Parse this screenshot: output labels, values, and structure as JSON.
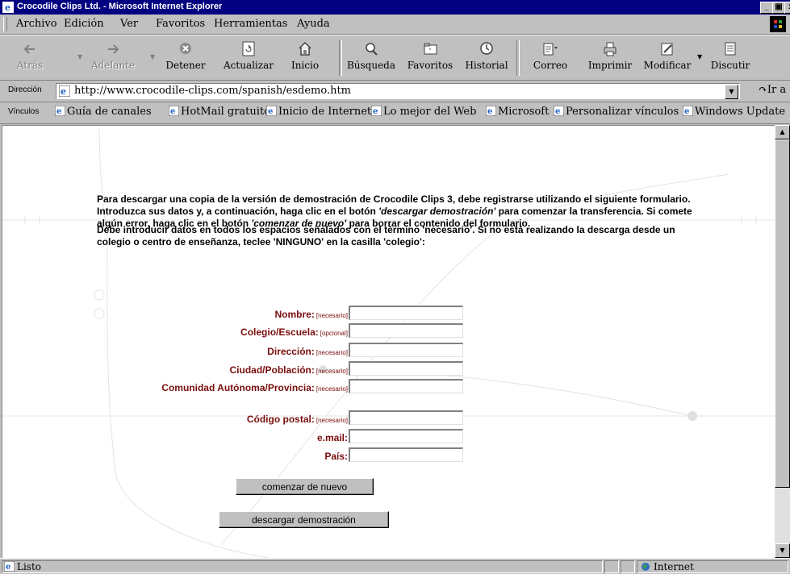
{
  "window": {
    "title": "Crocodile Clips Ltd. - Microsoft Internet Explorer"
  },
  "menu": [
    "Archivo",
    "Edición",
    "Ver",
    "Favoritos",
    "Herramientas",
    "Ayuda"
  ],
  "toolbar": {
    "back": "Atrás",
    "forward": "Adelante",
    "stop": "Detener",
    "refresh": "Actualizar",
    "home": "Inicio",
    "search": "Búsqueda",
    "favorites": "Favoritos",
    "history": "Historial",
    "mail": "Correo",
    "print": "Imprimir",
    "edit": "Modificar",
    "discuss": "Discutir"
  },
  "address": {
    "label": "Dirección",
    "url": "http://www.crocodile-clips.com/spanish/esdemo.htm",
    "go": "Ir a"
  },
  "links": {
    "label": "Vínculos",
    "items": [
      "Guía de canales",
      "HotMail gratuito",
      "Inicio de Internet",
      "Lo mejor del Web",
      "Microsoft",
      "Personalizar vínculos",
      "Windows Update"
    ]
  },
  "content": {
    "para1": {
      "a": "Para descargar una copia de la versión de demostración de Crocodile Clips 3, debe registrarse utilizando el siguiente formulario. Introduzca sus datos y, a continuación, haga clic en el botón ",
      "b": "'descargar demostración'",
      "c": " para comenzar la transferencia. Si comete algún error, haga clic en el botón ",
      "d": "'comenzar de nuevo'",
      "e": " para borrar el contenido del formulario."
    },
    "para2": "Debe introducir datos en todos los espacios señalados con el término 'necesario'. Si no está realizando la descarga desde un colegio o centro de enseñanza, teclee 'NINGUNO' en la casilla 'colegio':",
    "form": {
      "nombre": {
        "label": "Nombre:",
        "note": "[necesario]",
        "value": ""
      },
      "colegio": {
        "label": "Colegio/Escuela:",
        "note": "[opcional]",
        "value": ""
      },
      "direccion": {
        "label": "Dirección:",
        "note": "[necesario]",
        "value": ""
      },
      "ciudad": {
        "label": "Ciudad/Población:",
        "note": "[necesario]",
        "value": ""
      },
      "provincia": {
        "label": "Comunidad Autónoma/Provincia:",
        "note": "[necesario]",
        "value": ""
      },
      "cp": {
        "label": "Código postal:",
        "note": "[necesario]",
        "value": ""
      },
      "email": {
        "label": "e.mail:",
        "value": ""
      },
      "pais": {
        "label": "País:",
        "value": ""
      }
    },
    "reset_button": "comenzar de nuevo",
    "submit_button": "descargar demostración"
  },
  "status": {
    "text": "Listo",
    "zone": "Internet"
  }
}
